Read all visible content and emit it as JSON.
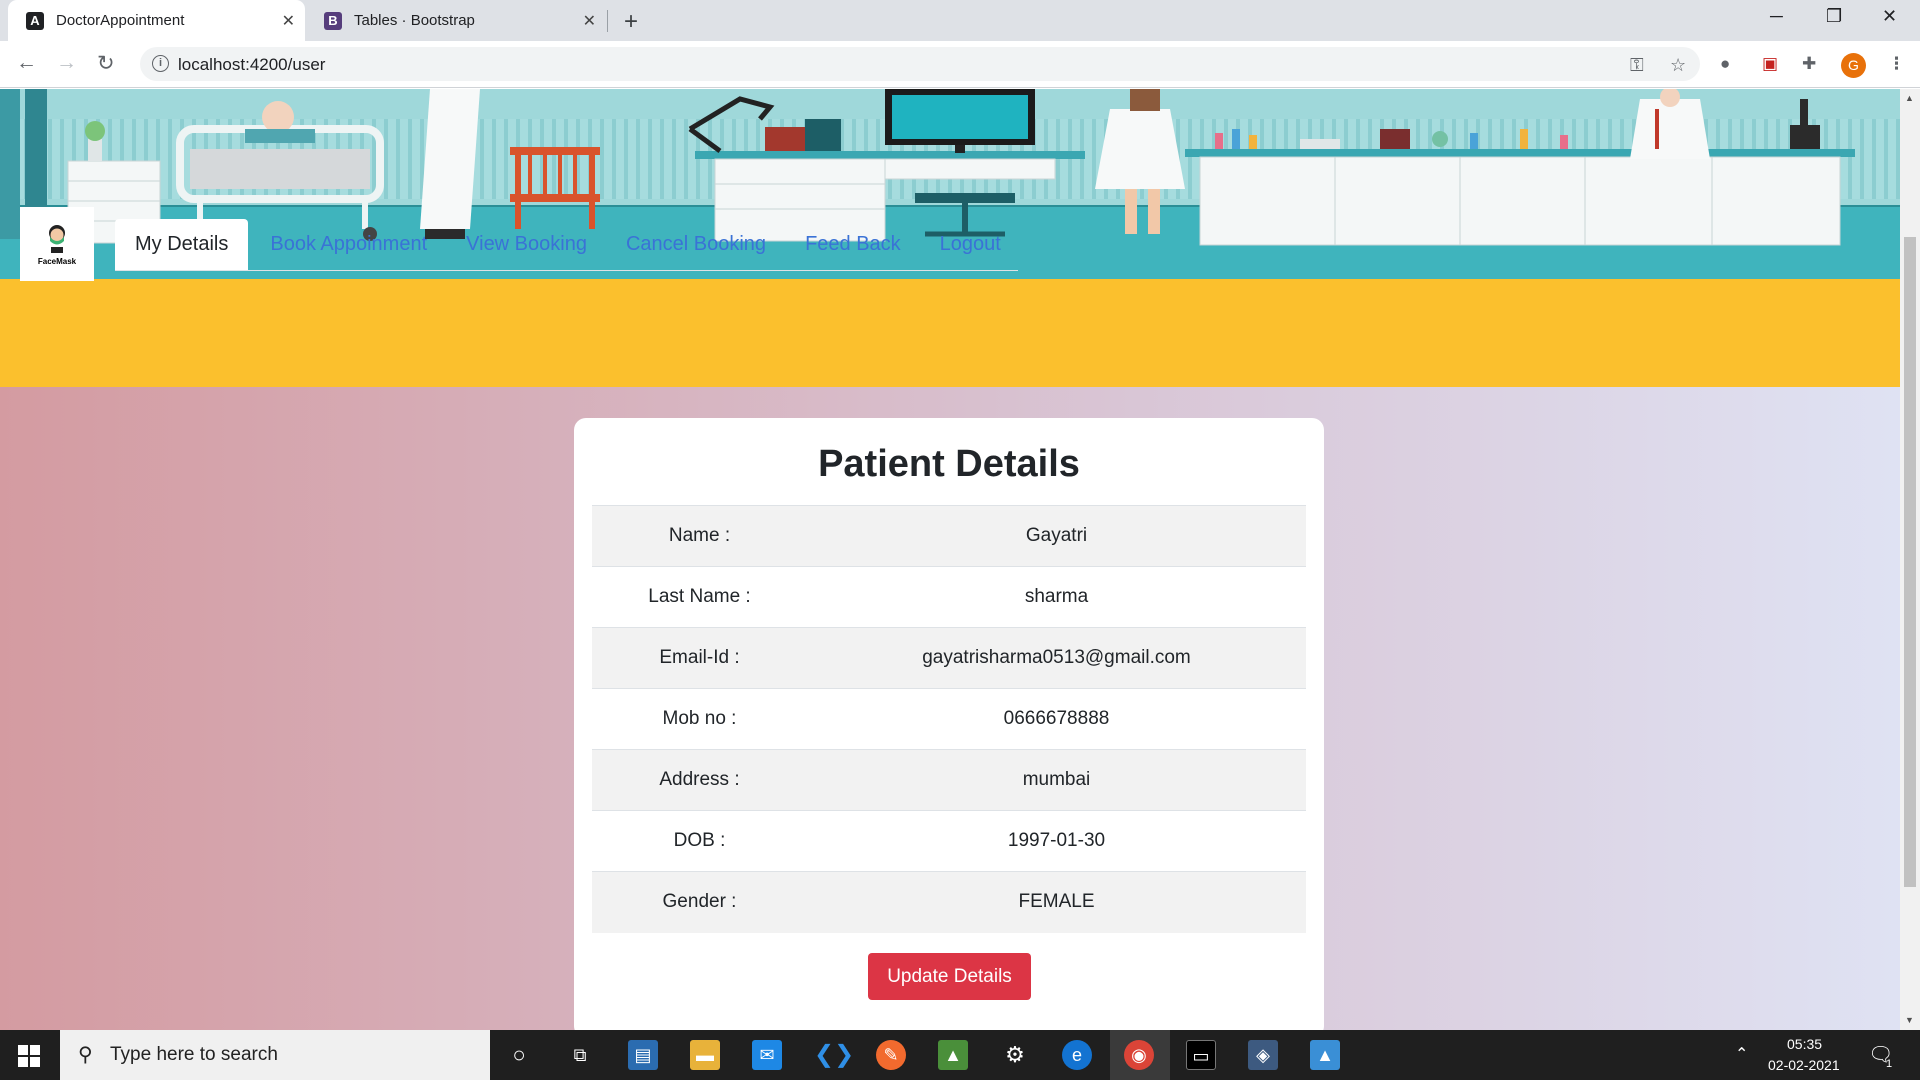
{
  "browser": {
    "tabs": [
      {
        "title": "DoctorAppointment",
        "favicon": "angular-icon",
        "active": true
      },
      {
        "title": "Tables · Bootstrap",
        "favicon": "bootstrap-icon",
        "active": false
      }
    ],
    "url": "localhost:4200/user",
    "profile_initial": "G"
  },
  "logo": {
    "text": "FaceMask"
  },
  "nav": {
    "tabs": [
      {
        "label": "My Details",
        "active": true
      },
      {
        "label": "Book Appoinment",
        "active": false
      },
      {
        "label": "View Booking",
        "active": false
      },
      {
        "label": "Cancel Booking",
        "active": false
      },
      {
        "label": "Feed Back",
        "active": false
      },
      {
        "label": "Logout",
        "active": false
      }
    ]
  },
  "card": {
    "title": "Patient Details",
    "rows": [
      {
        "label": "Name :",
        "value": "Gayatri"
      },
      {
        "label": "Last Name :",
        "value": "sharma"
      },
      {
        "label": "Email-Id :",
        "value": "gayatrisharma0513@gmail.com"
      },
      {
        "label": "Mob no :",
        "value": "0666678888"
      },
      {
        "label": "Address :",
        "value": "mumbai"
      },
      {
        "label": "DOB :",
        "value": "1997-01-30"
      },
      {
        "label": "Gender :",
        "value": "FEMALE"
      }
    ],
    "button_label": "Update Details"
  },
  "colors": {
    "navbar": "#fbc02d",
    "link": "#3a72d6",
    "button": "#dc3545"
  },
  "taskbar": {
    "search_placeholder": "Type here to search",
    "time": "05:35",
    "date": "02-02-2021",
    "notification_count": "1"
  }
}
